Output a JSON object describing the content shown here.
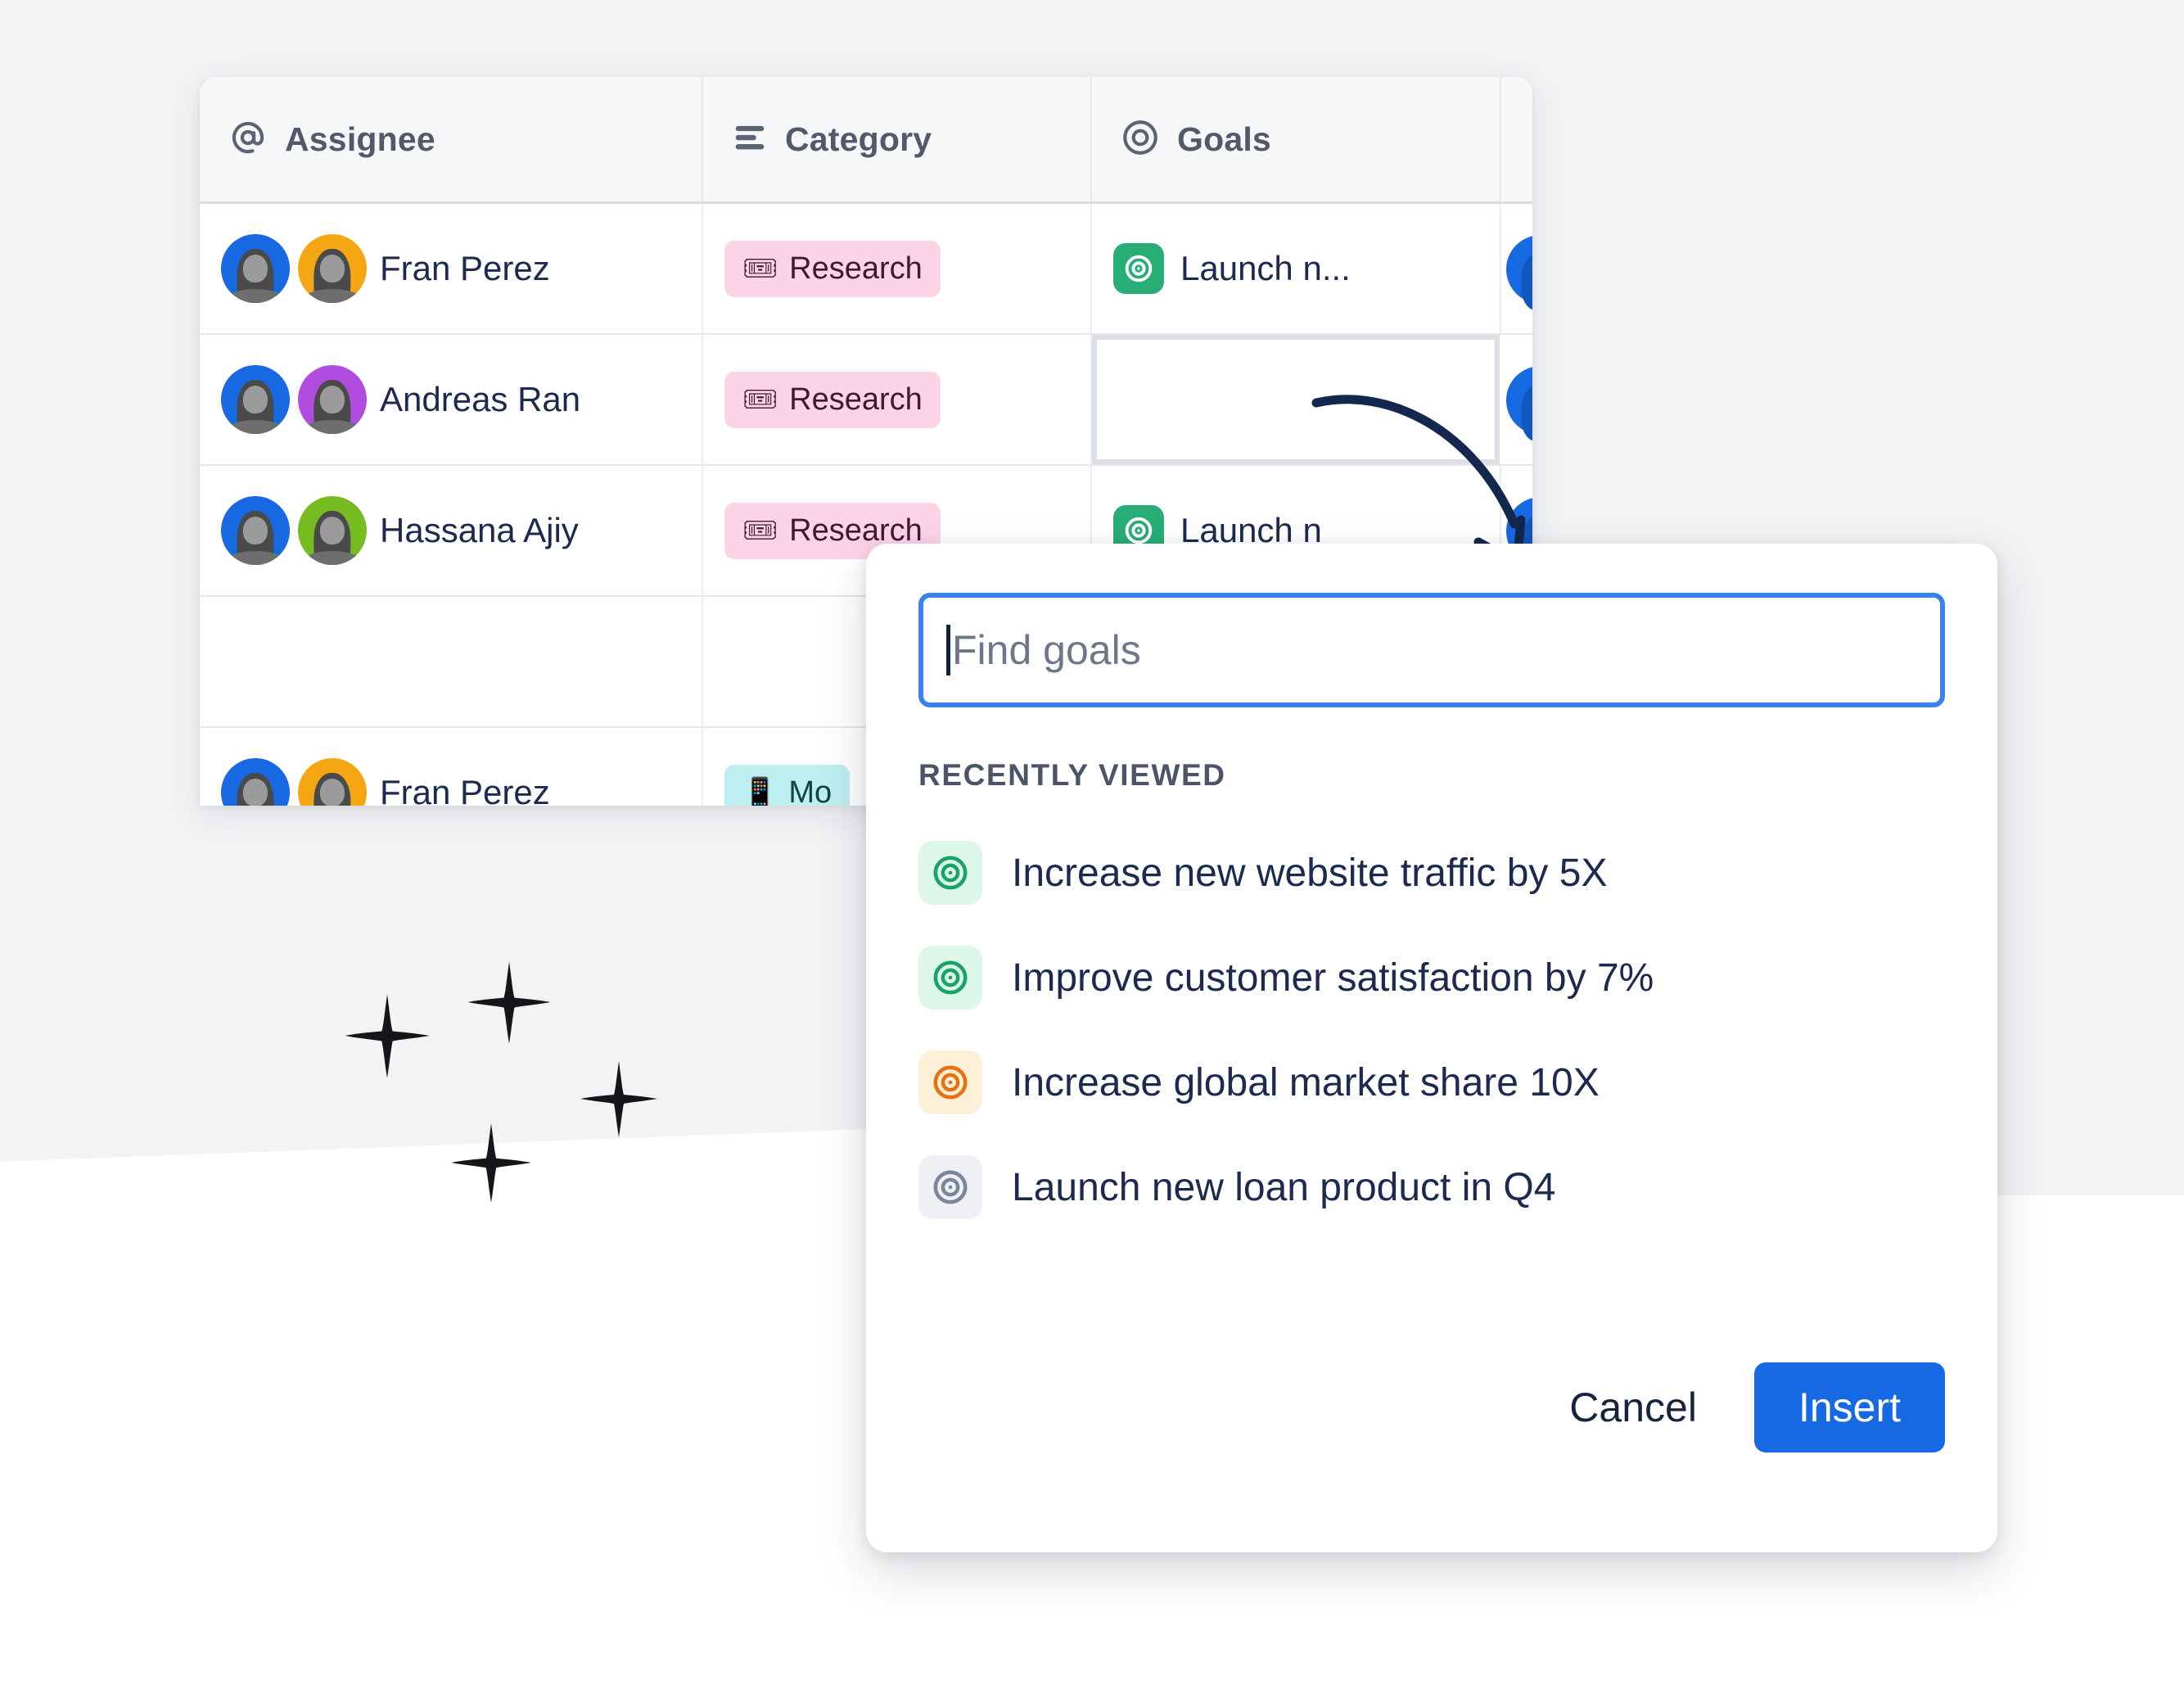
{
  "table": {
    "columns": [
      {
        "icon": "at-sign-icon",
        "label": "Assignee"
      },
      {
        "icon": "list-lines-icon",
        "label": "Category"
      },
      {
        "icon": "target-icon",
        "label": "Goals"
      }
    ],
    "rows": [
      {
        "assignee": "Fran Perez",
        "avatar_colors": [
          "#1668e3",
          "#f5a613"
        ],
        "category": {
          "label": "Research",
          "icon": "ticket-icon",
          "bg": "#fbd4e5",
          "fg": "#3f1a30"
        },
        "goal": {
          "label": "Launch n...",
          "icon": "target-icon",
          "color": "#27ae77"
        },
        "goal_selected": false
      },
      {
        "assignee": "Andreas Ran",
        "avatar_colors": [
          "#1668e3",
          "#b04ce0"
        ],
        "category": {
          "label": "Research",
          "icon": "ticket-icon",
          "bg": "#fbd4e5",
          "fg": "#3f1a30"
        },
        "goal": {
          "label": "",
          "icon": "",
          "color": ""
        },
        "goal_selected": true
      },
      {
        "assignee": "Hassana Ajiy",
        "avatar_colors": [
          "#1668e3",
          "#76bc21"
        ],
        "category": {
          "label": "Research",
          "icon": "ticket-icon",
          "bg": "#fbd4e5",
          "fg": "#3f1a30"
        },
        "goal": {
          "label": "Launch n",
          "icon": "target-icon",
          "color": "#27ae77"
        },
        "goal_selected": false
      },
      {
        "assignee": "",
        "avatar_colors": [],
        "category": {
          "label": "",
          "icon": "",
          "bg": "",
          "fg": ""
        },
        "goal": {
          "label": "",
          "icon": "",
          "color": ""
        },
        "goal_selected": false
      },
      {
        "assignee": "Fran Perez",
        "avatar_colors": [
          "#1668e3",
          "#f5a613"
        ],
        "category": {
          "label": "Mo",
          "icon": "mobile-icon",
          "bg": "#bdeef0",
          "fg": "#10414a"
        },
        "goal": {
          "label": "",
          "icon": "",
          "color": ""
        },
        "goal_selected": false
      }
    ]
  },
  "dialog": {
    "search": {
      "placeholder": "Find goals",
      "value": ""
    },
    "section_label": "RECENTLY VIEWED",
    "goals": [
      {
        "label": "Increase new website traffic by 5X",
        "ring": "#19a26a",
        "bg": "#ddf7e8"
      },
      {
        "label": "Improve customer satisfaction by 7%",
        "ring": "#19a26a",
        "bg": "#ddf7e8"
      },
      {
        "label": "Increase global market share 10X",
        "ring": "#e8700f",
        "bg": "#fdf0d8"
      },
      {
        "label": "Launch new loan product in Q4",
        "ring": "#7a869c",
        "bg": "#eef0f3"
      }
    ],
    "cancel_label": "Cancel",
    "insert_label": "Insert"
  },
  "colors": {
    "accent": "#1668e3",
    "focus_border": "#3b82e8",
    "background_band": "#f2f3f5",
    "text_dark": "#1b2a4e",
    "header_text": "#51596b"
  }
}
